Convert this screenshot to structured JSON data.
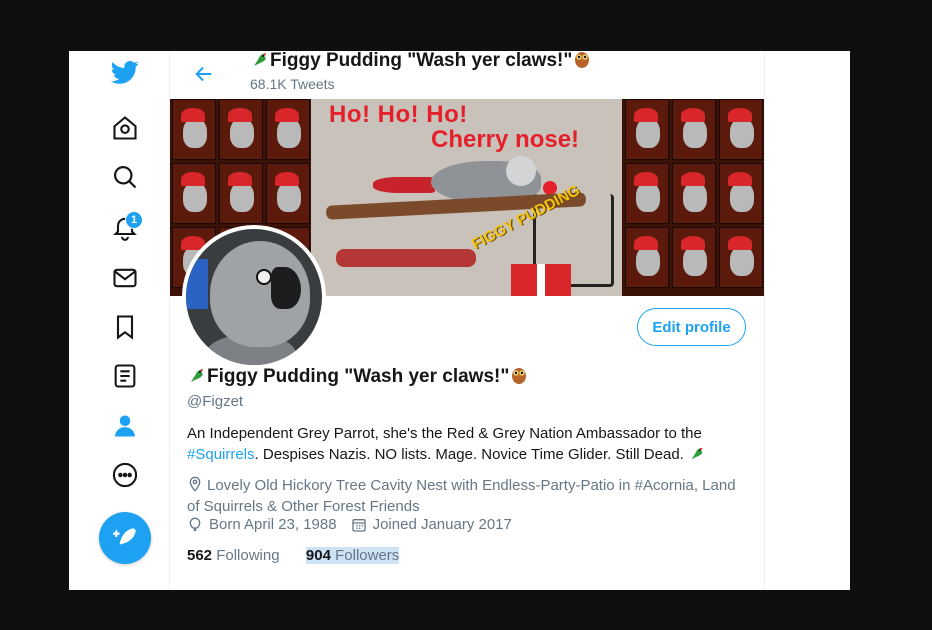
{
  "nav": {
    "notification_count": "1"
  },
  "header": {
    "name": "Figgy Pudding \"Wash yer claws!\"",
    "tweet_count": "68.1K Tweets"
  },
  "banner": {
    "line1": "Ho! Ho! Ho!",
    "line2": "Cherry nose!",
    "pudding_text": "FIGGY PUDDING"
  },
  "profile": {
    "edit_label": "Edit profile",
    "name": "Figgy Pudding \"Wash yer claws!\"",
    "handle": "@Figzet",
    "bio_part1": "An Independent Grey Parrot, she's the Red & Grey Nation Ambassador to the",
    "bio_link": "#Squirrels",
    "bio_part2": ". Despises Nazis. NO lists. Mage. Novice Time Glider. Still Dead.",
    "location": "Lovely Old Hickory Tree Cavity Nest with Endless-Party-Patio in #Acornia, Land of Squirrels & Other Forest Friends",
    "born": "Born April 23, 1988",
    "joined": "Joined January 2017",
    "following_count": "562",
    "following_label": "Following",
    "followers_count": "904",
    "followers_label": "Followers"
  },
  "colors": {
    "accent": "#1da1f2",
    "text": "#14171a",
    "muted": "#657786"
  }
}
